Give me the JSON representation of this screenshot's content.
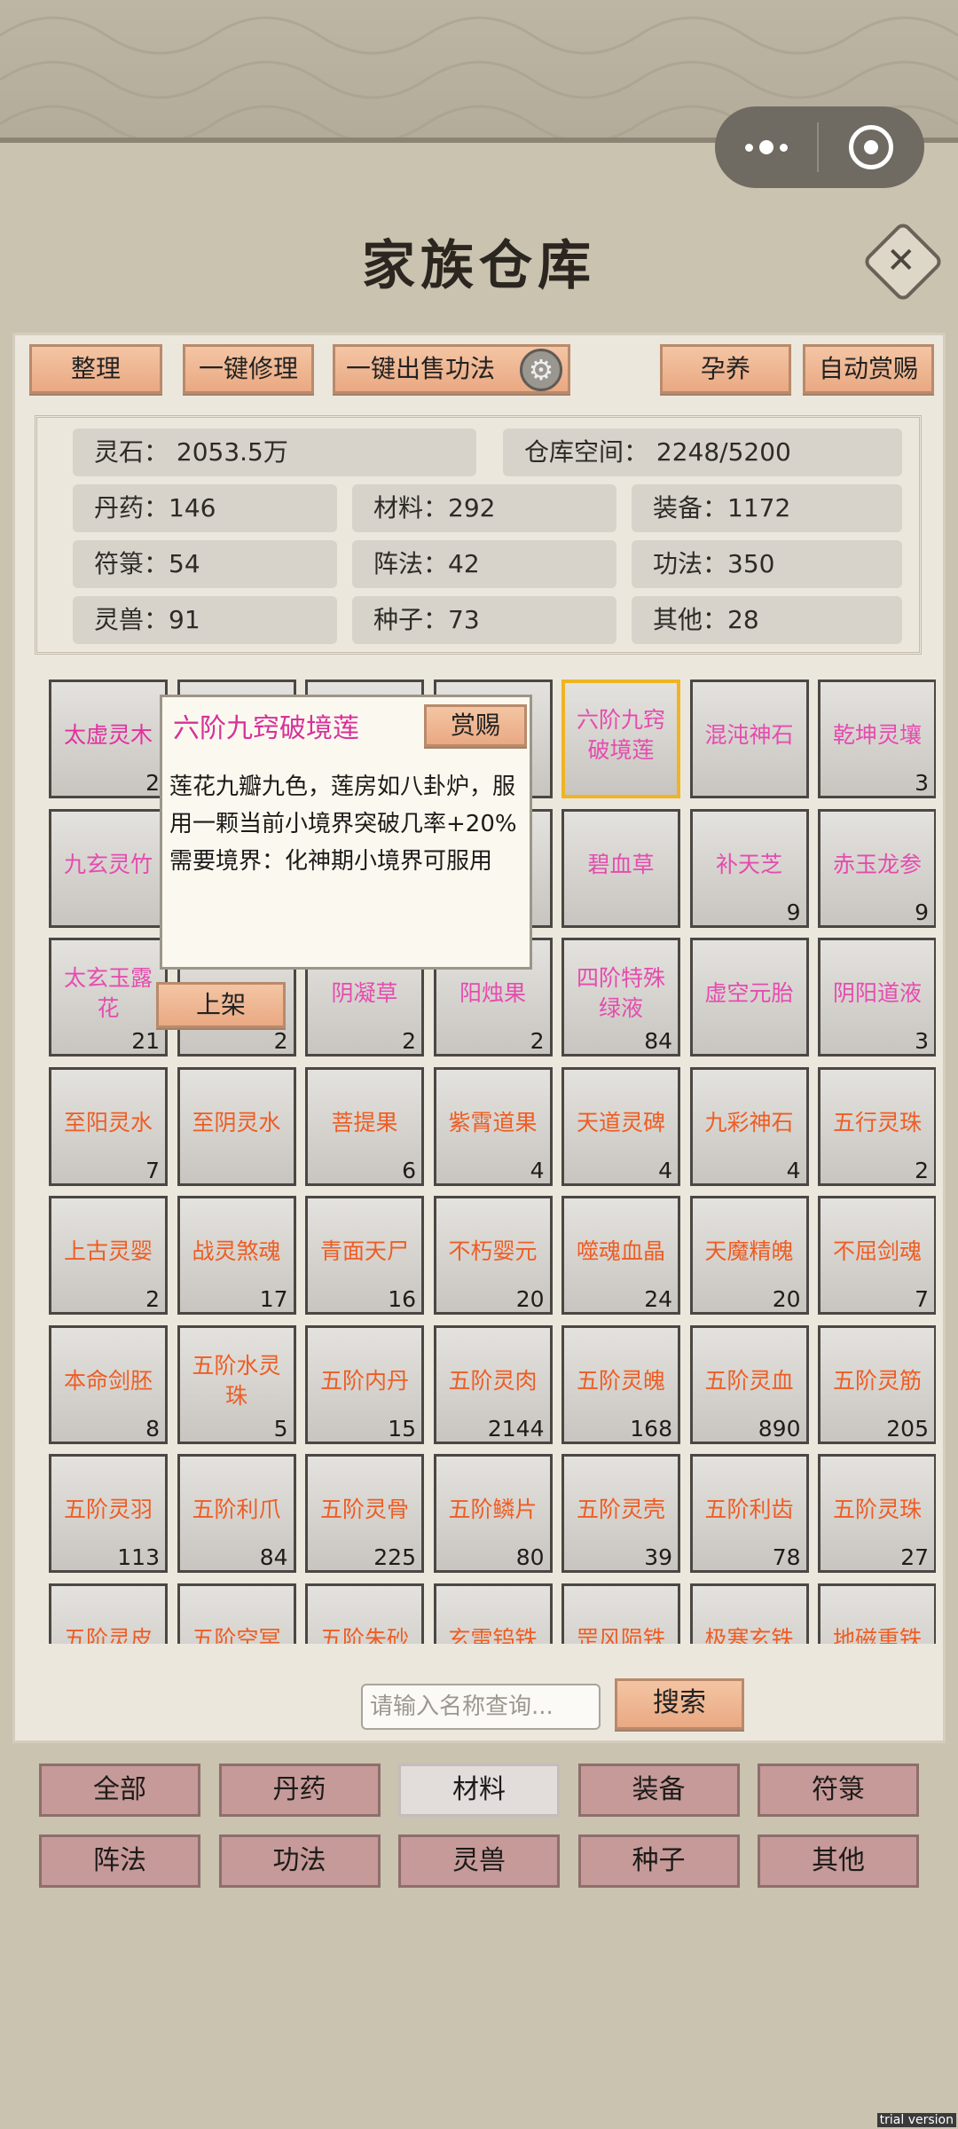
{
  "title": "家族仓库",
  "toolbar": {
    "sort": "整理",
    "repair_all": "一键修理",
    "sell_all": "一键出售功法",
    "nurture": "孕养",
    "auto_reward": "自动赏赐"
  },
  "stats": {
    "spirit_stone": "灵石：  2053.5万",
    "storage": "仓库空间：    2248/5200",
    "pills": "丹药：146",
    "materials": "材料：292",
    "equipment": "装备：1172",
    "talismans": "符箓：54",
    "formations": "阵法：42",
    "techniques": "功法：350",
    "beasts": "灵兽：91",
    "seeds": "种子：73",
    "others": "其他：28"
  },
  "tooltip": {
    "name": "六阶九窍破境莲",
    "reward_btn": "赏赐",
    "desc": "莲花九瓣九色，莲房如八卦炉，服用一颗当前小境界突破几率+20%",
    "req": "需要境界：化神期小境界可服用",
    "shelf_btn": "上架"
  },
  "items": [
    {
      "name": "太虚灵木",
      "count": "2",
      "color": "pink"
    },
    {
      "name": "",
      "count": "",
      "color": "pink"
    },
    {
      "name": "",
      "count": "",
      "color": "pink"
    },
    {
      "name": "",
      "count": "",
      "color": "pink"
    },
    {
      "name": "六阶九窍破境莲",
      "count": "",
      "color": "pink2",
      "selected": true
    },
    {
      "name": "混沌神石",
      "count": "",
      "color": "pink2"
    },
    {
      "name": "乾坤灵壤",
      "count": "3",
      "color": "pink2"
    },
    {
      "name": "九玄灵竹",
      "count": "",
      "color": "pink2"
    },
    {
      "name": "",
      "count": "",
      "color": "pink2"
    },
    {
      "name": "",
      "count": "",
      "color": "pink2"
    },
    {
      "name": "",
      "count": "",
      "color": "pink2"
    },
    {
      "name": "碧血草",
      "count": "",
      "color": "pink2"
    },
    {
      "name": "补天芝",
      "count": "9",
      "color": "pink2"
    },
    {
      "name": "赤玉龙参",
      "count": "9",
      "color": "pink2"
    },
    {
      "name": "太玄玉露花",
      "count": "21",
      "color": "pink2"
    },
    {
      "name": "",
      "count": "2",
      "color": "pink2"
    },
    {
      "name": "阴凝草",
      "count": "2",
      "color": "pink2"
    },
    {
      "name": "阳烛果",
      "count": "2",
      "color": "pink2"
    },
    {
      "name": "四阶特殊绿液",
      "count": "84",
      "color": "pink2"
    },
    {
      "name": "虚空元胎",
      "count": "",
      "color": "pink2"
    },
    {
      "name": "阴阳道液",
      "count": "3",
      "color": "pink2"
    },
    {
      "name": "至阳灵水",
      "count": "7",
      "color": "orange"
    },
    {
      "name": "至阴灵水",
      "count": "",
      "color": "orange"
    },
    {
      "name": "菩提果",
      "count": "6",
      "color": "orange"
    },
    {
      "name": "紫霄道果",
      "count": "4",
      "color": "orange"
    },
    {
      "name": "天道灵碑",
      "count": "4",
      "color": "orange"
    },
    {
      "name": "九彩神石",
      "count": "4",
      "color": "orange"
    },
    {
      "name": "五行灵珠",
      "count": "2",
      "color": "orange"
    },
    {
      "name": "上古灵婴",
      "count": "2",
      "color": "orange"
    },
    {
      "name": "战灵煞魂",
      "count": "17",
      "color": "orange"
    },
    {
      "name": "青面天尸",
      "count": "16",
      "color": "orange"
    },
    {
      "name": "不朽婴元",
      "count": "20",
      "color": "orange"
    },
    {
      "name": "噬魂血晶",
      "count": "24",
      "color": "orange"
    },
    {
      "name": "天魔精魄",
      "count": "20",
      "color": "orange"
    },
    {
      "name": "不屈剑魂",
      "count": "7",
      "color": "orange"
    },
    {
      "name": "本命剑胚",
      "count": "8",
      "color": "orange"
    },
    {
      "name": "五阶水灵珠",
      "count": "5",
      "color": "orange"
    },
    {
      "name": "五阶内丹",
      "count": "15",
      "color": "orange"
    },
    {
      "name": "五阶灵肉",
      "count": "2144",
      "color": "orange"
    },
    {
      "name": "五阶灵魄",
      "count": "168",
      "color": "orange"
    },
    {
      "name": "五阶灵血",
      "count": "890",
      "color": "orange"
    },
    {
      "name": "五阶灵筋",
      "count": "205",
      "color": "orange"
    },
    {
      "name": "五阶灵羽",
      "count": "113",
      "color": "orange"
    },
    {
      "name": "五阶利爪",
      "count": "84",
      "color": "orange"
    },
    {
      "name": "五阶灵骨",
      "count": "225",
      "color": "orange"
    },
    {
      "name": "五阶鳞片",
      "count": "80",
      "color": "orange"
    },
    {
      "name": "五阶灵壳",
      "count": "39",
      "color": "orange"
    },
    {
      "name": "五阶利齿",
      "count": "78",
      "color": "orange"
    },
    {
      "name": "五阶灵珠",
      "count": "27",
      "color": "orange"
    },
    {
      "name": "五阶灵皮",
      "count": "",
      "color": "orange"
    },
    {
      "name": "五阶空冥",
      "count": "",
      "color": "orange"
    },
    {
      "name": "五阶朱砂",
      "count": "",
      "color": "orange"
    },
    {
      "name": "玄雷钨铁",
      "count": "",
      "color": "orange"
    },
    {
      "name": "罡风陨铁",
      "count": "",
      "color": "orange"
    },
    {
      "name": "极寒玄铁",
      "count": "",
      "color": "orange"
    },
    {
      "name": "地磁重铁",
      "count": "",
      "color": "orange"
    }
  ],
  "search": {
    "placeholder": "请输入名称查询...",
    "button": "搜索"
  },
  "tabs": [
    "全部",
    "丹药",
    "材料",
    "装备",
    "符箓",
    "阵法",
    "功法",
    "灵兽",
    "种子",
    "其他"
  ],
  "active_tab": "材料",
  "watermark": "trial version",
  "icons": {
    "close": "close-icon",
    "gear": "gear-icon",
    "more": "more-dots-icon",
    "target": "target-icon"
  }
}
